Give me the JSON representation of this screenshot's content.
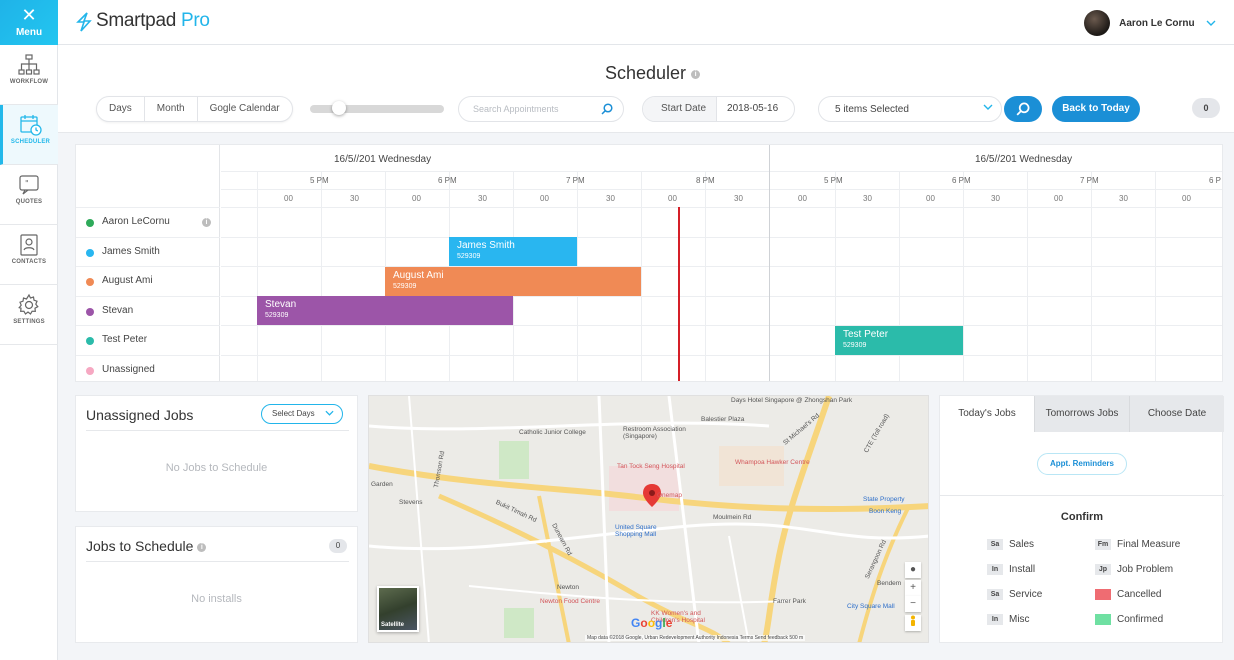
{
  "app": {
    "brand": "Smartpad",
    "brand_suffix": "Pro",
    "menu_label": "Menu"
  },
  "user": {
    "name": "Aaron Le Cornu"
  },
  "sidebar": {
    "items": [
      {
        "label": "WORKFLOW",
        "icon": "workflow-icon"
      },
      {
        "label": "SCHEDULER",
        "icon": "calendar-clock-icon"
      },
      {
        "label": "QUOTES",
        "icon": "quote-bubble-icon"
      },
      {
        "label": "CONTACTS",
        "icon": "contact-card-icon"
      },
      {
        "label": "SETTINGS",
        "icon": "gear-icon"
      }
    ]
  },
  "header": {
    "title": "Scheduler",
    "info": "i",
    "views": [
      "Days",
      "Month",
      "Gogle Calendar"
    ],
    "zoom_level": 0.22,
    "search_placeholder": "Search Appointments",
    "start_date_label": "Start Date",
    "start_date_value": "2018-05-16",
    "selection": "5 items Selected",
    "back_to_today": "Back to Today",
    "count": "0"
  },
  "scheduler": {
    "days": [
      "16/5//201 Wednesday",
      "16/5//201 Wednesday"
    ],
    "hours": [
      "5 PM",
      "6 PM",
      "7 PM",
      "8 PM",
      "5 PM",
      "6 PM",
      "7 PM",
      "6 P"
    ],
    "minute_labels": [
      "00",
      "30"
    ],
    "resources": [
      {
        "name": "Aaron LeCornu",
        "color": "#2eaa5a",
        "info": "i"
      },
      {
        "name": "James Smith",
        "color": "#28b6f0"
      },
      {
        "name": "August Ami",
        "color": "#f08a55"
      },
      {
        "name": "Stevan",
        "color": "#9c55a8"
      },
      {
        "name": "Test Peter",
        "color": "#2bbbaa"
      },
      {
        "name": "Unassigned",
        "color": "#f6a8c2"
      }
    ],
    "events": [
      {
        "name": "James Smith",
        "code": "529309",
        "color": "#29b6f0"
      },
      {
        "name": "August Ami",
        "code": "529309",
        "color": "#f08a55"
      },
      {
        "name": "Stevan",
        "code": "529309",
        "color": "#9c55a8"
      },
      {
        "name": "Test Peter",
        "code": "529309",
        "color": "#2bbbaa"
      }
    ]
  },
  "unassigned": {
    "title": "Unassigned Jobs",
    "filter": "Select Days",
    "empty": "No Jobs to Schedule"
  },
  "jobs": {
    "title": "Jobs to Schedule",
    "info": "i",
    "count": "0",
    "empty": "No installs"
  },
  "map": {
    "labels": {
      "days_hotel": "Days Hotel Singapore @ Zhongshan Park",
      "catholic": "Catholic Junior College",
      "restroom": "Restroom Association (Singapore)",
      "balestier": "Balestier Plaza",
      "ttsh": "Tan Tock Seng Hospital",
      "whampoa": "Whampoa Hawker Centre",
      "onemap": "Onemap",
      "moulmein": "Moulmein Rd",
      "state_property": "State Property",
      "boon_keng": "Boon Keng",
      "united_square": "United Square Shopping Mall",
      "stevens": "Stevens",
      "bukit_timah": "Bukit Timah Rd",
      "dunearn": "Dunearn Rd",
      "newton": "Newton",
      "newton_food": "Newton Food Centre",
      "kkh": "KK Women's and Children's Hospital",
      "farrer_park": "Farrer Park",
      "city_square": "City Square Mall",
      "bendem": "Bendem",
      "garden": "Garden",
      "cte": "CTE (Toll road)",
      "serangoon": "Serangoon Rd",
      "thomson": "Thomson Rd",
      "st_michaels": "St Michael's Rd"
    },
    "satellite": "Satellite",
    "google": "Google",
    "footer": "Map data ©2018 Google, Urban Redevelopment Authority   Indonesia   Terms   Send feedback   500 m"
  },
  "right_panel": {
    "tabs": [
      "Today's Jobs",
      "Tomorrows Jobs",
      "Choose Date"
    ],
    "reminder_button": "Appt. Reminders",
    "confirm_title": "Confirm",
    "legend": [
      {
        "tag": "Sa",
        "label": "Sales"
      },
      {
        "tag": "Fm",
        "label": "Final Measure"
      },
      {
        "tag": "In",
        "label": "Install"
      },
      {
        "tag": "Jp",
        "label": "Job Problem"
      },
      {
        "tag": "Sa",
        "label": "Service"
      },
      {
        "swatch": "#ef6c72",
        "label": "Cancelled"
      },
      {
        "tag": "In",
        "label": "Misc"
      },
      {
        "swatch": "#6fe0a2",
        "label": "Confirmed"
      }
    ]
  }
}
